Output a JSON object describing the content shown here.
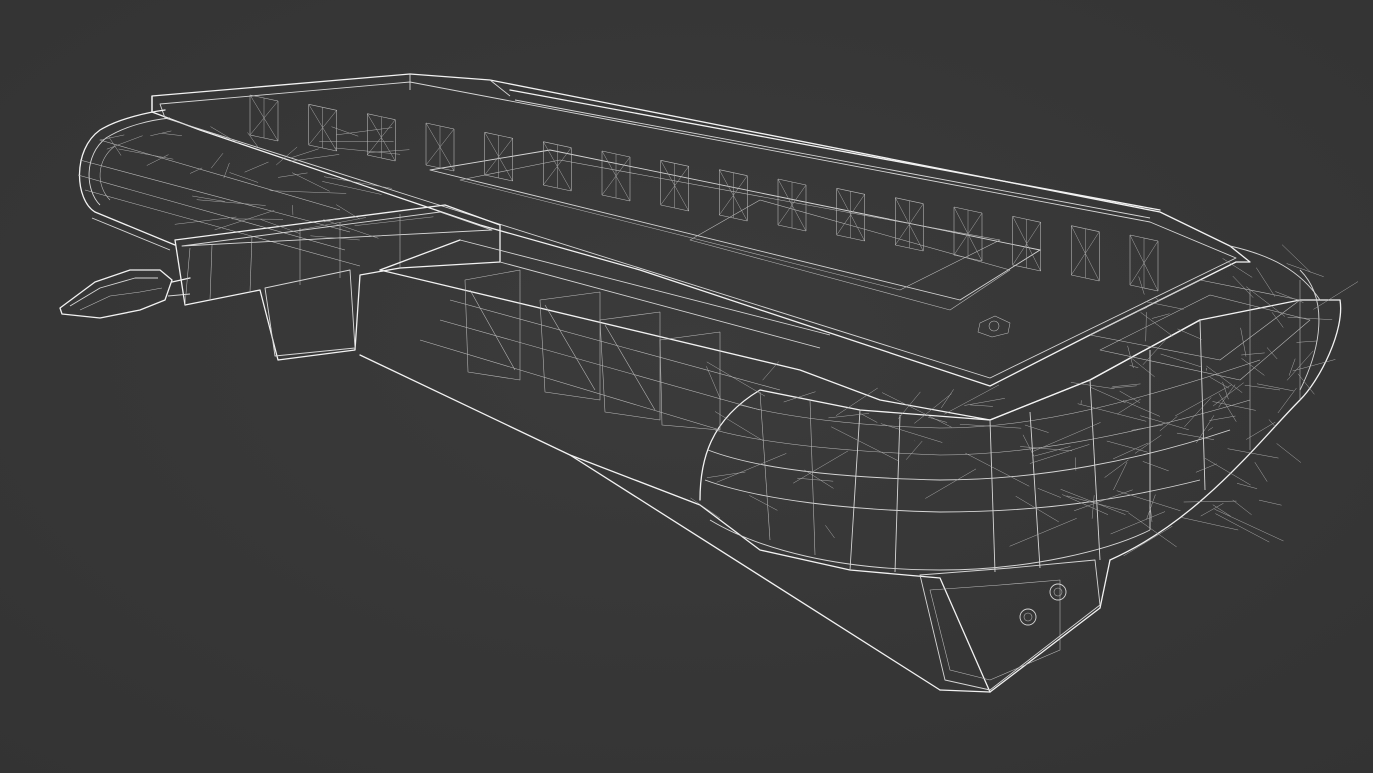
{
  "scene": {
    "subject": "lightbar-wireframe",
    "render_mode": "wireframe",
    "colors": {
      "background_center": "#3b3b3b",
      "background_edge": "#333333",
      "wire_primary": "#f2f2f2",
      "wire_secondary": "#bdbdbd"
    }
  }
}
